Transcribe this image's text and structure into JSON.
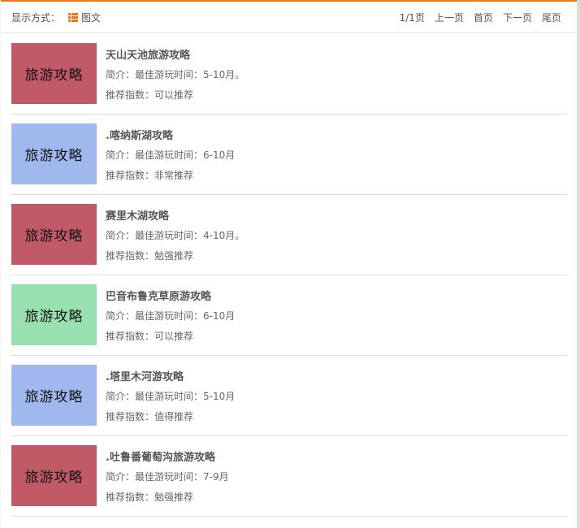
{
  "view": {
    "label": "显示方式：",
    "mode_icon": "list-icon",
    "mode": "图文"
  },
  "pager": {
    "page": "1/1页",
    "prev": "上一页",
    "first": "首页",
    "next": "下一页",
    "last": "尾页"
  },
  "colors": {
    "accent": "#f0741a",
    "red_thumb": "#c05a66",
    "blue_thumb": "#9fb9ef",
    "green_thumb": "#98e0b0"
  },
  "items": [
    {
      "thumb_text": "旅游攻略",
      "thumb_color": "#c05a66",
      "title": "天山天池旅游攻略",
      "intro": "简介：最佳游玩时间：5-10月。",
      "rec": "推荐指数：可以推荐"
    },
    {
      "thumb_text": "旅游攻略",
      "thumb_color": "#9fb9ef",
      "title": ".喀纳斯湖攻略",
      "intro": "简介：最佳游玩时间：6-10月",
      "rec": "推荐指数：非常推荐"
    },
    {
      "thumb_text": "旅游攻略",
      "thumb_color": "#c05a66",
      "title": "赛里木湖攻略",
      "intro": "简介：最佳游玩时间：4-10月。",
      "rec": "推荐指数：勉强推荐"
    },
    {
      "thumb_text": "旅游攻略",
      "thumb_color": "#98e0b0",
      "title": "巴音布鲁克草原游攻略",
      "intro": "简介：最佳游玩时间：6-10月",
      "rec": "推荐指数：可以推荐"
    },
    {
      "thumb_text": "旅游攻略",
      "thumb_color": "#9fb9ef",
      "title": ".塔里木河游攻略",
      "intro": "简介：最佳游玩时间：5-10月",
      "rec": "推荐指数：值得推荐"
    },
    {
      "thumb_text": "旅游攻略",
      "thumb_color": "#c05a66",
      "title": ".吐鲁番葡萄沟旅游攻略",
      "intro": "简介：最佳游玩时间：7-9月",
      "rec": "推荐指数：勉强推荐"
    }
  ]
}
